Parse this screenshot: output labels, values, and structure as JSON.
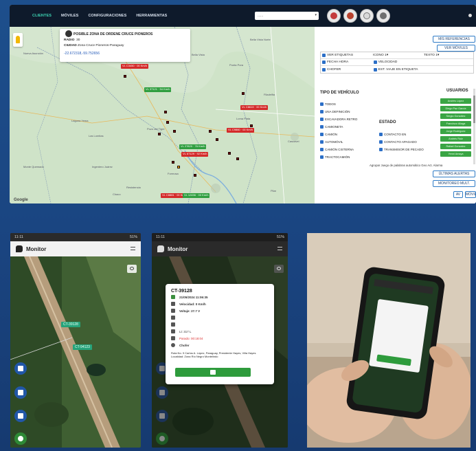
{
  "desktop": {
    "nav": [
      "CLIENTES",
      "MÓVILES",
      "CONFIGURACIONES",
      "HERRAMIENTAS"
    ],
    "select_placeholder": "......",
    "zone_card": {
      "title": "POSIBLE ZONA DE ORDENE CRUCE PIONEROS",
      "radio_label": "RADIO",
      "radio_value": "30",
      "ciudad_label": "CIUDAD",
      "ciudad_value": "Zona Cruce Pioneros-Paraguay",
      "coords": "-22.672318,-59.752656"
    },
    "map_places": [
      "Nueva Asunción",
      "Bella Vista",
      "Punta Pora",
      "Bella Vista Norte",
      "Filadelfia",
      "Loma Plata",
      "Laguna Yema",
      "Las Lomitas",
      "Pozo del Tigre",
      "Ingeniero Juárez",
      "Formosa",
      "Resistencia",
      "Pilar",
      "Cascavel",
      "Monte Quemado",
      "Chaco"
    ],
    "vehicle_labels": [
      {
        "text": "VL 37121 · 54 Km/h",
        "color": "green"
      },
      {
        "text": "VL C8619 · 00 Km/h",
        "color": "red"
      },
      {
        "text": "VL C9860 · 00 Km/h",
        "color": "red"
      },
      {
        "text": "VL 27820 · 76 Km/h",
        "color": "green"
      },
      {
        "text": "VL 67129 · 92 Km/h",
        "color": "red"
      },
      {
        "text": "VL C3450 · 00 Km/h",
        "color": "red"
      },
      {
        "text": "VL C8881 · 00 Km/h",
        "color": "red"
      },
      {
        "text": "VL 12456 · 00 Km/h",
        "color": "green"
      }
    ],
    "google": "Google",
    "panel": {
      "btn_referencias": "MIS REFERENCIAS",
      "btn_ver_moviles": "VER MÓVILES",
      "chk_rows": [
        [
          "VER ETIQUETAS",
          "ICONO 1▾",
          "TEXTO 1▾"
        ],
        [
          "FECHA HORA",
          "VELOCIDAD"
        ],
        [
          "CHOFER",
          "EST. VIAJE EN ETIQUETA"
        ]
      ],
      "tipo_title": "TIPO DE VEHÍCULO",
      "tipo_items": [
        "TODOS",
        "UNA DEFINICIÓN",
        "EXCAVADORA RETRO",
        "CAMIONETA",
        "CAMIÓN",
        "AUTOMÓVIL",
        "CAMIÓN CISTERNA",
        "TRACTOCAMIÓN"
      ],
      "estado_title": "ESTADO",
      "estado_items": [
        "CONTACTO EN",
        "CONTACTO APAGADO",
        "TRANSMISOR DE PECADO"
      ],
      "usuarios_title": "USUARIOS",
      "usuarios": [
        "Andrés López",
        "Diego Paz García",
        "Sergio González",
        "Francisco Aliaga",
        "Jorge Rodríguez",
        "Andrés Ruiz",
        "Rafael Gonzalez",
        "Yenni Amaya"
      ],
      "options_line": "Agrupar  Juego de palabras automático  Geo Act.  Alarma",
      "btn_ultimas": "ÚLTIMAS ALERTAS",
      "btn_monitoreo": "MONITOREO MULT.",
      "btn_av": "AV",
      "btn_moviles": "MÓVILES"
    }
  },
  "phone1": {
    "time": "11:11",
    "battery": "51%",
    "app_name": "Monitor",
    "tags": [
      "CT-39128",
      "CT-94123"
    ]
  },
  "phone2": {
    "time": "11:11",
    "battery": "51%",
    "app_name": "Monitor",
    "popup": {
      "id": "CT-39128",
      "datetime": "21/05/2024 11:06:35",
      "velocidad": "Velocidad: 0 Km/h",
      "voltaje": "Voltaje: 27.7 V",
      "combustible": "Lt: 317 L",
      "estado": "Parado: 00:18:04",
      "chofer": "Chofer",
      "address": "Ruta No. 9 Carlos A. López, Paraguay, Presidente Hayes, Villa Hayes Localidad: Zona Río Negro Montelindo"
    }
  },
  "colors": {
    "background": "#1a4480",
    "topbar": "#0e1a2b",
    "accent_green": "#2e9b3c",
    "accent_blue": "#2e7bc6",
    "alert_red": "#d42a2a"
  }
}
